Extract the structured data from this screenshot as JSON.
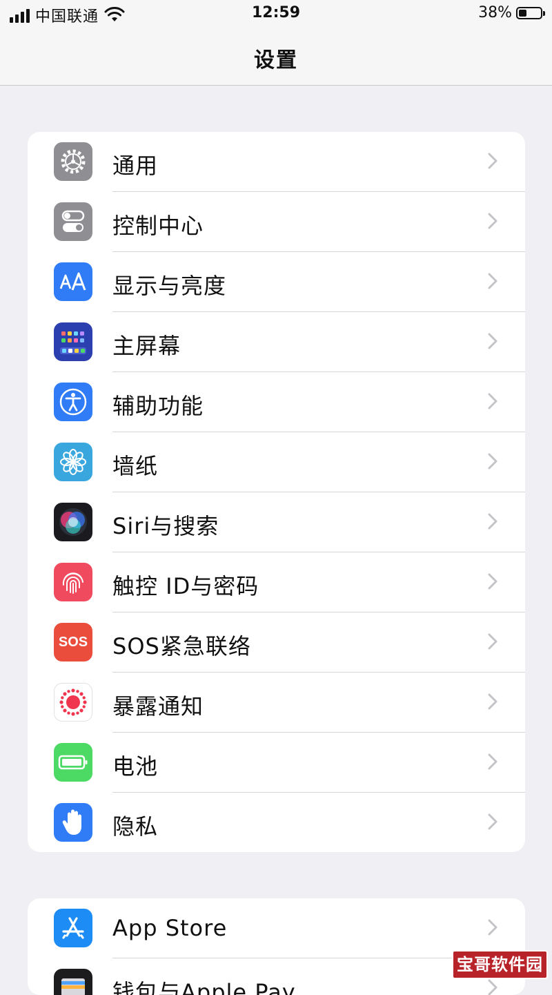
{
  "status_bar": {
    "carrier": "中国联通",
    "time": "12:59",
    "battery_percent_text": "38%",
    "battery_level": 0.38,
    "signal_bars": 4
  },
  "nav": {
    "title": "设置"
  },
  "settings_groups": [
    {
      "items": [
        {
          "label": "通用",
          "icon": "gear-icon",
          "icon_color": "#8e8e93"
        },
        {
          "label": "控制中心",
          "icon": "toggles-icon",
          "icon_color": "#8e8e93"
        },
        {
          "label": "显示与亮度",
          "icon": "display-aa-icon",
          "icon_color": "#2f7cf6"
        },
        {
          "label": "主屏幕",
          "icon": "home-screen-icon",
          "icon_color": "#2c3fae"
        },
        {
          "label": "辅助功能",
          "icon": "accessibility-icon",
          "icon_color": "#2f7cf6"
        },
        {
          "label": "墙纸",
          "icon": "flower-icon",
          "icon_color": "#39a7de"
        },
        {
          "label": "Siri与搜索",
          "icon": "siri-icon",
          "icon_color": "#1b1b1f"
        },
        {
          "label": "触控 ID与密码",
          "icon": "fingerprint-icon",
          "icon_color": "#ef4a5e"
        },
        {
          "label": "SOS紧急联络",
          "icon": "sos-icon",
          "icon_color": "#eb4d3d",
          "icon_text": "SOS"
        },
        {
          "label": "暴露通知",
          "icon": "exposure-icon",
          "icon_color": "#ffffff"
        },
        {
          "label": "电池",
          "icon": "battery-icon",
          "icon_color": "#4cd964"
        },
        {
          "label": "隐私",
          "icon": "hand-icon",
          "icon_color": "#2f7cf6"
        }
      ]
    },
    {
      "items": [
        {
          "label": "App Store",
          "icon": "app-store-icon",
          "icon_color": "#1e8cf5"
        },
        {
          "label": "钱包与Apple Pay",
          "icon": "wallet-icon",
          "icon_color": "#1c1c1e"
        }
      ]
    }
  ],
  "watermark": {
    "text": "宝哥软件园"
  }
}
